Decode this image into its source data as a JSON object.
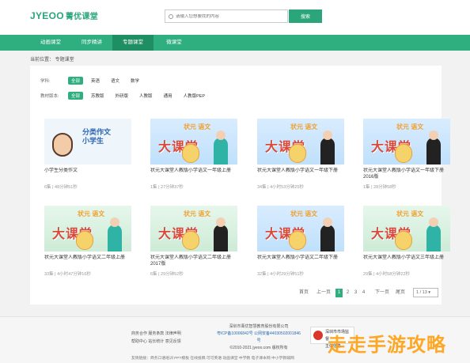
{
  "header": {
    "logo_latin": "JYEOO",
    "logo_cn": "菁优课堂",
    "search_placeholder": "请输入您想要找的内容",
    "search_button": "搜索"
  },
  "nav": {
    "items": [
      "动画课堂",
      "同步精讲",
      "专题课堂",
      "微课堂"
    ],
    "active_index": 2
  },
  "breadcrumb": "当前位置： 专题课堂",
  "filters": {
    "subject_label": "学科:",
    "subjects": [
      "全部",
      "英语",
      "语文",
      "数学"
    ],
    "edition_label": "教材版本:",
    "editions": [
      "全部",
      "苏教版",
      "外研版",
      "人教版",
      "通用",
      "人教版PEP"
    ]
  },
  "cards": [
    {
      "title": "小学生分类作文",
      "meta": "6集 | 48分钟51秒",
      "thumb_text": "分类作文 小学生"
    },
    {
      "title": "状元大课堂人教版小学语文一年级上册",
      "meta": "1集 | 27分钟37秒",
      "thumb_text": "状元 语文 大课堂"
    },
    {
      "title": "状元大课堂人教版小学语文一年级下册",
      "meta": "34集 | 4小时53分钟25秒",
      "thumb_text": "状元 语文 大课堂"
    },
    {
      "title": "状元大课堂人教版小学语文一年级下册2016版",
      "meta": "1集 | 28分钟58秒",
      "thumb_text": "状元 语文 大课堂"
    },
    {
      "title": "状元大课堂人教版小学语文二年级上册",
      "meta": "33集 | 4小时47分钟16秒",
      "thumb_text": "状元 语文 大课堂"
    },
    {
      "title": "状元大课堂人教版小学语文二年级上册2017版",
      "meta": "6集 | 29分钟52秒",
      "thumb_text": "状元 语文 大课堂"
    },
    {
      "title": "状元大课堂人教版小学语文二年级下册",
      "meta": "32集 | 4小时29分钟51秒",
      "thumb_text": "状元 语文 大课堂"
    },
    {
      "title": "状元大课堂人教版小学语文三年级上册",
      "meta": "29集 | 4小时58分钟22秒",
      "thumb_text": "状元 语文 大课堂"
    }
  ],
  "pager": {
    "first": "首页",
    "prev": "上一页",
    "pages": [
      "1",
      "2",
      "3",
      "4"
    ],
    "active_page": "1",
    "next": "下一页",
    "last": "尾页",
    "select_value": "1 / 13"
  },
  "footer": {
    "links_line1": "商务合作  服务条款  法律声明",
    "links_line2": "帮助中心  站长统计  意见反馈",
    "company": "深圳市菁优智慧教育股份有限公司",
    "icp": "粤ICP备10006842号  公网安备44030502001846号",
    "copyright": "©2010-2021 jyeoo.com 版权所有",
    "badge_line1": "深圳市市场监督",
    "badge_line2": "主体信息",
    "bottom_links": "友情链接：商务口语培训   PPT模板   在线投稿   可可英语   动画课堂   中学教   电子课本网   中小学教辅网"
  },
  "watermark": "走走手游攻略"
}
